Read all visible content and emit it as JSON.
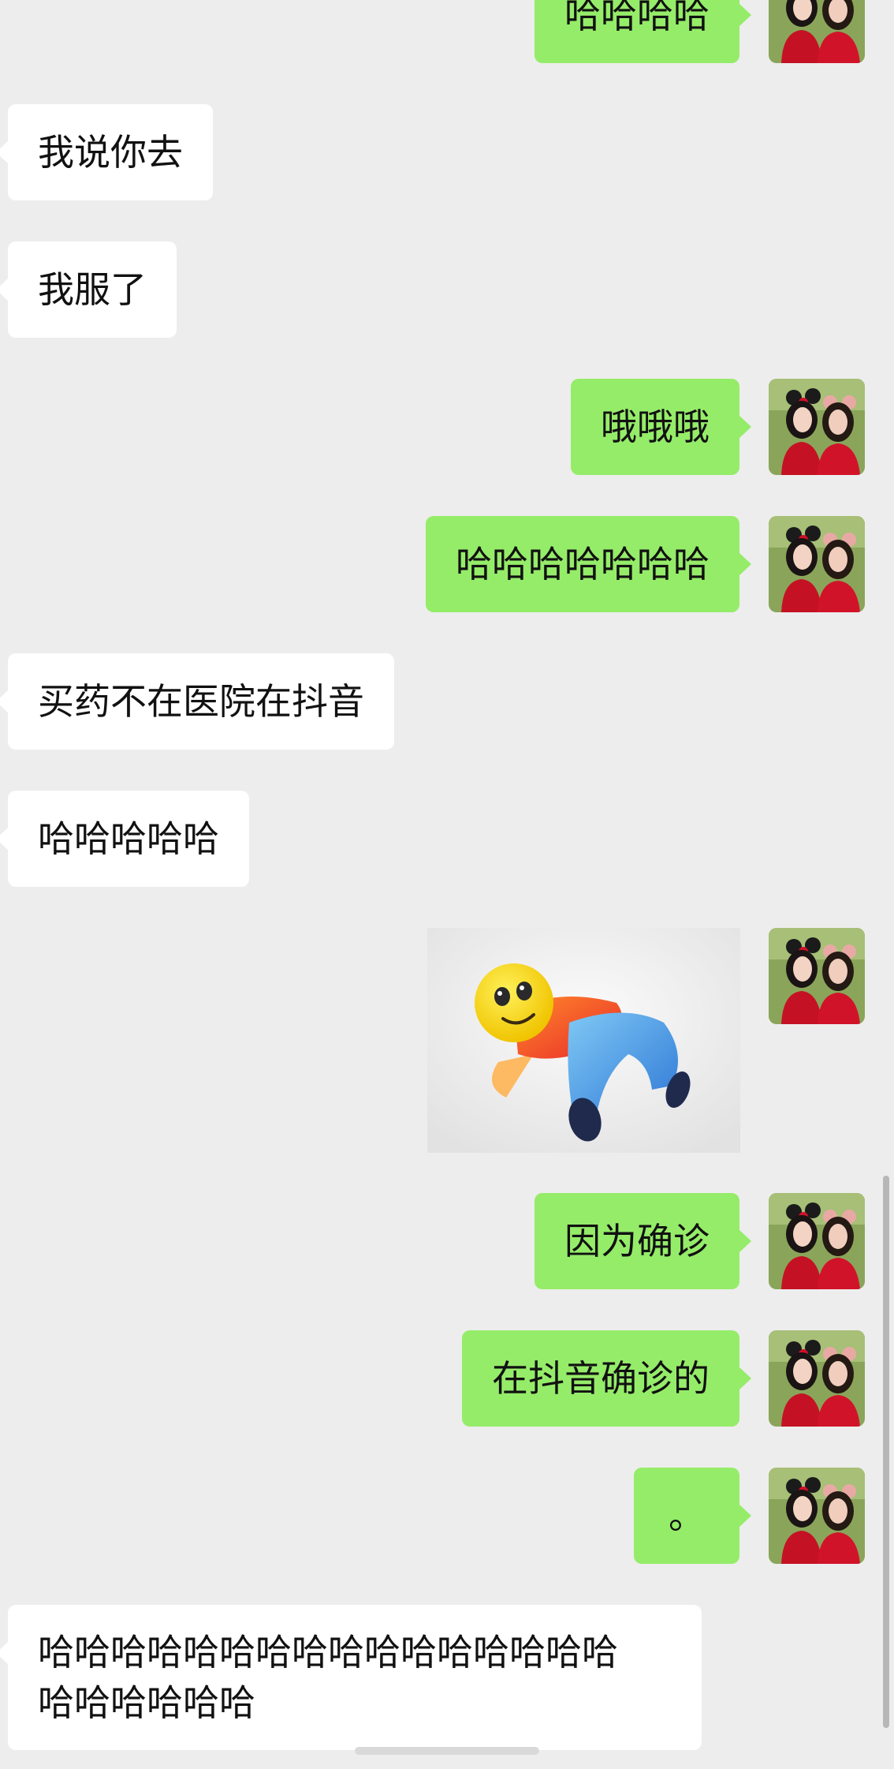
{
  "colors": {
    "background": "#ededed",
    "outgoing_bubble": "#95ec69",
    "incoming_bubble": "#ffffff",
    "text": "#111111"
  },
  "avatar_icon": "profile-photo-two-girls-red-dresses-mouse-ears",
  "sticker_icon": "yellow-smiley-face-figure-lying-down",
  "messages": [
    {
      "side": "out",
      "text": "哈哈哈哈"
    },
    {
      "side": "in",
      "text": "我说你去"
    },
    {
      "side": "in",
      "text": "我服了"
    },
    {
      "side": "out",
      "text": "哦哦哦"
    },
    {
      "side": "out",
      "text": "哈哈哈哈哈哈哈"
    },
    {
      "side": "in",
      "text": "买药不在医院在抖音"
    },
    {
      "side": "in",
      "text": "哈哈哈哈哈"
    },
    {
      "side": "out",
      "type": "sticker"
    },
    {
      "side": "out",
      "text": "因为确诊"
    },
    {
      "side": "out",
      "text": "在抖音确诊的"
    },
    {
      "side": "out",
      "text": "。"
    },
    {
      "side": "in",
      "lines": [
        "哈哈哈哈哈哈哈哈哈哈哈哈哈哈哈哈",
        "哈哈哈哈哈哈"
      ]
    }
  ]
}
